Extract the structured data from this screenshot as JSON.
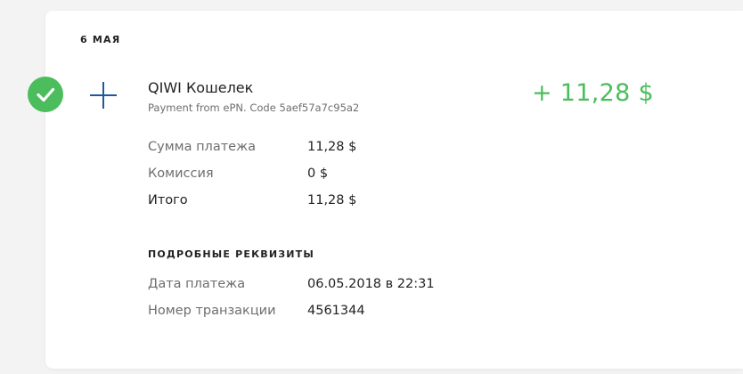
{
  "date_header": "6 МАЯ",
  "status": {
    "icon": "check-icon",
    "color": "#4bbd5c"
  },
  "transaction": {
    "icon": "plus-icon",
    "provider": "QIWI Кошелек",
    "comment": "Payment from ePN. Code 5aef57a7c95a2",
    "amount": "+ 11,28 $"
  },
  "summary": [
    {
      "label": "Сумма платежа",
      "value": "11,28 $"
    },
    {
      "label": "Комиссия",
      "value": "0 $"
    },
    {
      "label": "Итого",
      "value": "11,28 $"
    }
  ],
  "details": {
    "title": "ПОДРОБНЫЕ РЕКВИЗИТЫ",
    "rows": [
      {
        "label": "Дата платежа",
        "value": "06.05.2018 в 22:31"
      },
      {
        "label": "Номер транзакции",
        "value": "4561344"
      }
    ]
  },
  "colors": {
    "accent_green": "#4bbd5c",
    "icon_blue": "#1e5a9a"
  }
}
